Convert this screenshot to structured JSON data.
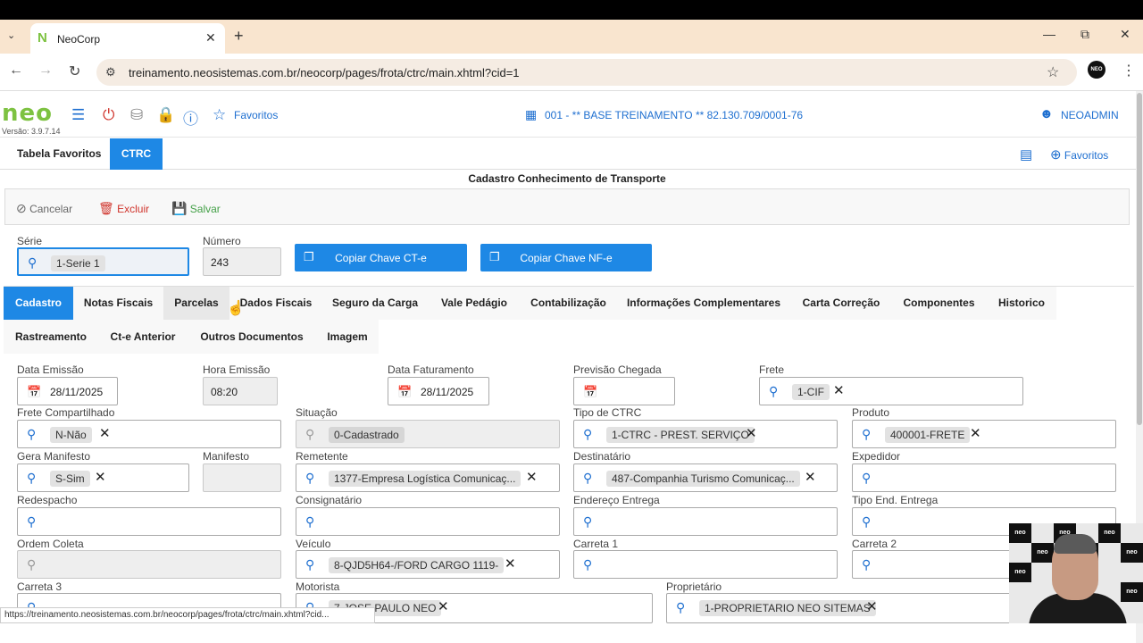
{
  "browser": {
    "tab_title": "NeoCorp",
    "url": "treinamento.neosistemas.com.br/neocorp/pages/frota/ctrc/main.xhtml?cid=1",
    "status_url": "https://treinamento.neosistemas.com.br/neocorp/pages/frota/ctrc/main.xhtml?cid...",
    "profile_label": "NEO"
  },
  "app": {
    "logo": "neo",
    "version": "Versão: 3.9.7.14",
    "favorites": "Favoritos",
    "company": "001 - ** BASE TREINAMENTO ** 82.130.709/0001-76",
    "user": "NEOADMIN"
  },
  "menu_tabs": {
    "tab1": "Tabela Favoritos",
    "tab2": "CTRC",
    "favorites": "Favoritos"
  },
  "form": {
    "title": "Cadastro Conhecimento de Transporte",
    "toolbar": {
      "cancel": "Cancelar",
      "delete": "Excluir",
      "save": "Salvar"
    },
    "serie_label": "Série",
    "serie_value": "1-Serie 1",
    "numero_label": "Número",
    "numero_value": "243",
    "copy_cte": "Copiar Chave CT-e",
    "copy_nfe": "Copiar Chave NF-e"
  },
  "tabs_row1": [
    "Cadastro",
    "Notas Fiscais",
    "Parcelas",
    "Dados Fiscais",
    "Seguro da Carga",
    "Vale Pedágio",
    "Contabilização",
    "Informações Complementares",
    "Carta Correção",
    "Componentes",
    "Historico"
  ],
  "tabs_row2": [
    "Rastreamento",
    "Ct-e Anterior",
    "Outros Documentos",
    "Imagem"
  ],
  "fields": {
    "data_emissao": {
      "label": "Data Emissão",
      "value": "28/11/2025"
    },
    "hora_emissao": {
      "label": "Hora Emissão",
      "value": "08:20"
    },
    "data_faturamento": {
      "label": "Data Faturamento",
      "value": "28/11/2025"
    },
    "previsao_chegada": {
      "label": "Previsão Chegada",
      "value": ""
    },
    "frete": {
      "label": "Frete",
      "value": "1-CIF"
    },
    "frete_compartilhado": {
      "label": "Frete Compartilhado",
      "value": "N-Não"
    },
    "situacao": {
      "label": "Situação",
      "value": "0-Cadastrado"
    },
    "tipo_ctrc": {
      "label": "Tipo de CTRC",
      "value": "1-CTRC - PREST. SERVIÇO"
    },
    "produto": {
      "label": "Produto",
      "value": "400001-FRETE"
    },
    "gera_manifesto": {
      "label": "Gera Manifesto",
      "value": "S-Sim"
    },
    "manifesto": {
      "label": "Manifesto",
      "value": ""
    },
    "remetente": {
      "label": "Remetente",
      "value": "1377-Empresa Logística Comunicaç..."
    },
    "destinatario": {
      "label": "Destinatário",
      "value": "487-Companhia Turismo Comunicaç..."
    },
    "expedidor": {
      "label": "Expedidor",
      "value": ""
    },
    "redespacho": {
      "label": "Redespacho",
      "value": ""
    },
    "consignatario": {
      "label": "Consignatário",
      "value": ""
    },
    "endereco_entrega": {
      "label": "Endereço Entrega",
      "value": ""
    },
    "tipo_end_entrega": {
      "label": "Tipo End. Entrega",
      "value": ""
    },
    "ordem_coleta": {
      "label": "Ordem Coleta",
      "value": ""
    },
    "veiculo": {
      "label": "Veículo",
      "value": "8-QJD5H64-/FORD CARGO 1119-"
    },
    "carreta1": {
      "label": "Carreta 1",
      "value": ""
    },
    "carreta2": {
      "label": "Carreta 2",
      "value": ""
    },
    "carreta3": {
      "label": "Carreta 3",
      "value": ""
    },
    "motorista": {
      "label": "Motorista",
      "value": "7-JOSE PAULO NEO"
    },
    "proprietario": {
      "label": "Proprietário",
      "value": "1-PROPRIETARIO NEO SITEMAS"
    }
  },
  "colors": {
    "accent": "#1e88e5",
    "brand_green": "#7dc241",
    "tab_bar": "#f9e5cf",
    "danger": "#d0342c",
    "success": "#43a047"
  },
  "webcam_tiles": [
    "neo",
    "neo",
    "neo",
    "neo",
    "neo",
    "neo",
    "neo",
    "neo"
  ]
}
